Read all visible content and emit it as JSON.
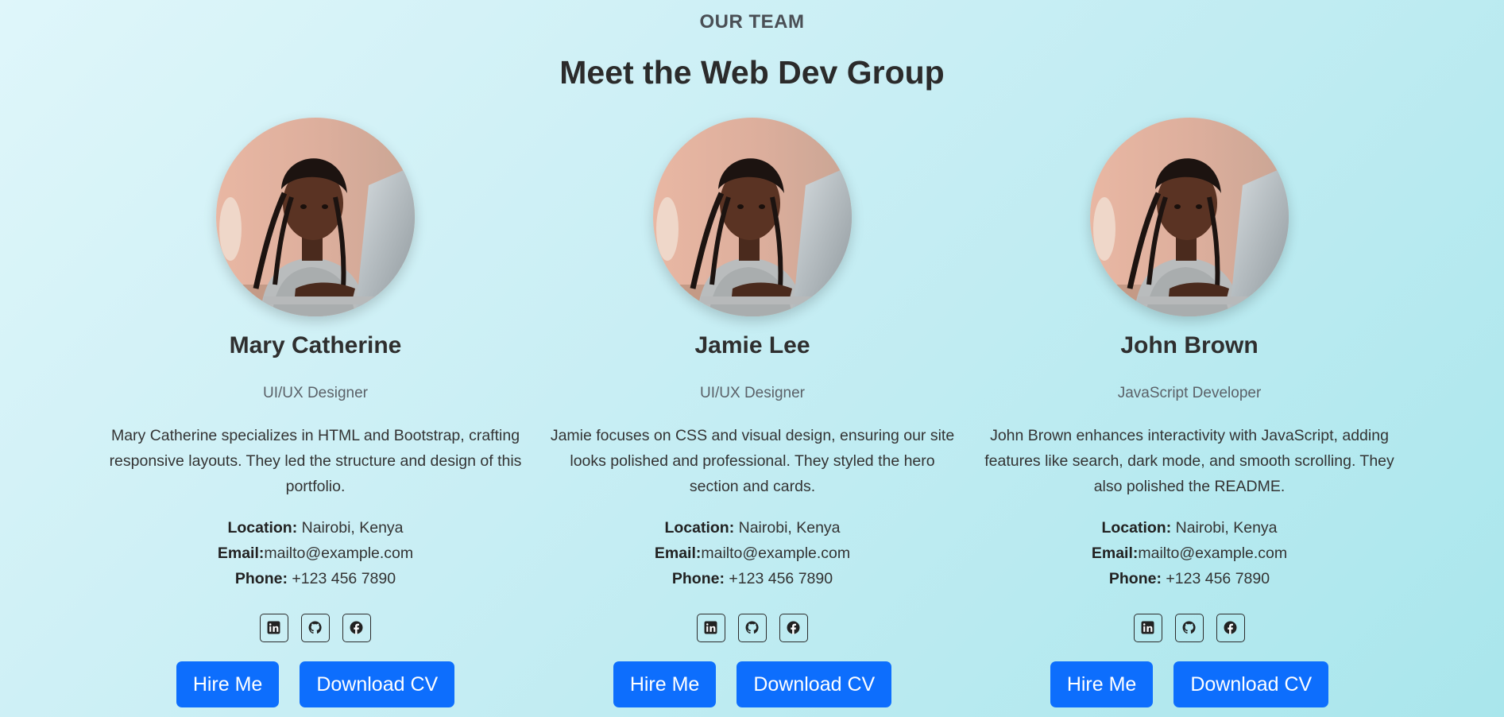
{
  "section": {
    "eyebrow": "OUR TEAM",
    "heading": "Meet the Web Dev Group"
  },
  "colors": {
    "accent": "#0d6efd",
    "background_start": "#dff6fa",
    "background_end": "#a9e6ec"
  },
  "labels": {
    "location": "Location:",
    "email": "Email:",
    "phone": "Phone:"
  },
  "members": [
    {
      "name": "Mary Catherine",
      "role": "UI/UX Designer",
      "bio": "Mary Catherine specializes in HTML and Bootstrap, crafting responsive layouts. They led the structure and design of this portfolio.",
      "location": "Nairobi, Kenya",
      "email": "mailto@example.com",
      "phone": "+123 456 7890",
      "socials": [
        "linkedin-icon",
        "github-icon",
        "facebook-icon"
      ],
      "hire_label": "Hire Me",
      "cv_label": "Download CV"
    },
    {
      "name": "Jamie Lee",
      "role": "UI/UX Designer",
      "bio": "Jamie focuses on CSS and visual design, ensuring our site looks polished and professional. They styled the hero section and cards.",
      "location": "Nairobi, Kenya",
      "email": "mailto@example.com",
      "phone": "+123 456 7890",
      "socials": [
        "linkedin-icon",
        "github-icon",
        "facebook-icon"
      ],
      "hire_label": "Hire Me",
      "cv_label": "Download CV"
    },
    {
      "name": "John Brown",
      "role": "JavaScript Developer",
      "bio": "John Brown enhances interactivity with JavaScript, adding features like search, dark mode, and smooth scrolling. They also polished the README.",
      "location": "Nairobi, Kenya",
      "email": "mailto@example.com",
      "phone": "+123 456 7890",
      "socials": [
        "linkedin-icon",
        "github-icon",
        "facebook-icon"
      ],
      "hire_label": "Hire Me",
      "cv_label": "Download CV"
    }
  ]
}
